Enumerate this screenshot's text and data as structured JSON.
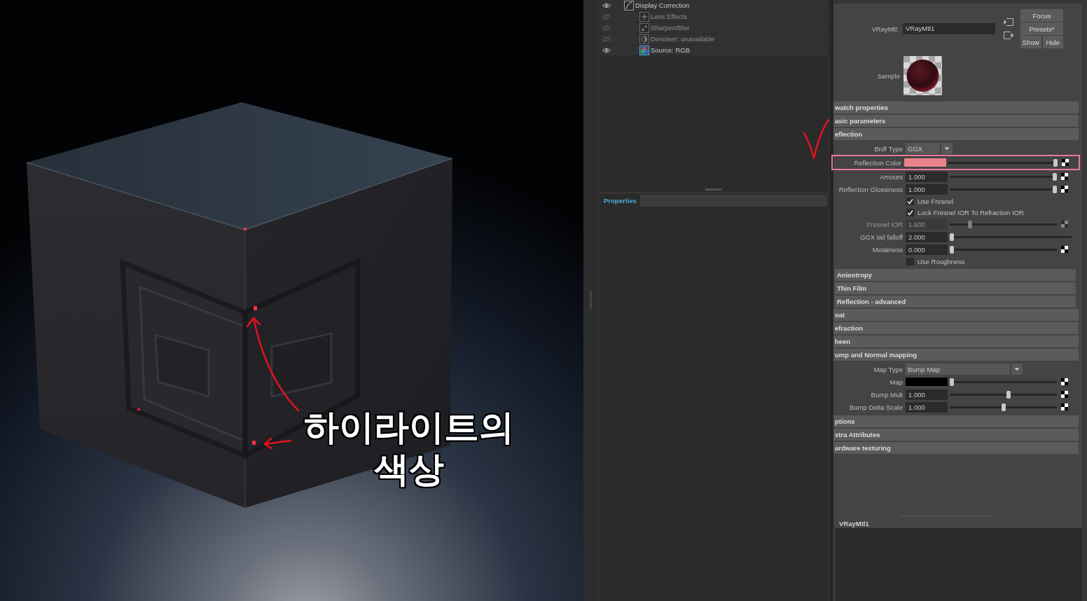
{
  "render": {
    "caption_lines": [
      "하이라이트의",
      "색상"
    ]
  },
  "layers": [
    {
      "name": "Display Correction",
      "kind": "correction",
      "visible": true,
      "children": [
        {
          "name": "Lens Effects",
          "kind": "lens",
          "visible": false
        },
        {
          "name": "Sharpen/Blur",
          "kind": "sharpen",
          "visible": false
        },
        {
          "name": "Denoiser: unavailable",
          "kind": "denoiser",
          "visible": false
        },
        {
          "name": "Source: RGB",
          "kind": "source",
          "visible": true
        }
      ]
    }
  ],
  "properties_tab": {
    "label": "Properties"
  },
  "material": {
    "type_label": "VRayMtl:",
    "name": "VRayMtl1",
    "sample_label": "Sample",
    "button_rows": [
      [
        "Focus"
      ],
      [
        "Presets*"
      ],
      [
        "Show",
        "Hide"
      ]
    ]
  },
  "sections": [
    {
      "title": "watch properties"
    },
    {
      "title": "asic parameters"
    },
    {
      "title": "eflection",
      "rows": [
        {
          "kind": "dropdown",
          "label": "Brdf Type",
          "value": "GGX",
          "disabled": false,
          "highlighted": false
        },
        {
          "kind": "color",
          "label": "Reflection Color",
          "color": "#e8848a",
          "level": 1,
          "map_button": true,
          "disabled": false,
          "highlighted": true
        },
        {
          "kind": "number",
          "label": "Amount",
          "value": "1.000",
          "level": 1,
          "map_button": true,
          "disabled": false,
          "highlighted": false
        },
        {
          "kind": "number",
          "label": "Reflection Glossiness",
          "value": "1.000",
          "level": 1,
          "map_button": true,
          "disabled": false,
          "highlighted": false
        },
        {
          "kind": "checkbox",
          "label": "Use Fresnel",
          "checked": true,
          "disabled": false,
          "highlighted": false
        },
        {
          "kind": "checkbox",
          "label": "Lock Fresnel IOR To Refraction IOR",
          "checked": true,
          "disabled": false,
          "highlighted": false
        },
        {
          "kind": "number",
          "label": "Fresnel IOR",
          "value": "1.600",
          "level": 0.18,
          "map_button": true,
          "disabled": true,
          "highlighted": false
        },
        {
          "kind": "number",
          "label": "GGX tail falloff",
          "value": "2.000",
          "level": 0,
          "map_button": false,
          "disabled": false,
          "highlighted": false
        },
        {
          "kind": "number",
          "label": "Metalness",
          "value": "0.000",
          "level": 0,
          "map_button": true,
          "disabled": false,
          "highlighted": false
        },
        {
          "kind": "checkbox",
          "label": "Use Roughness",
          "checked": false,
          "disabled": false,
          "highlighted": false
        }
      ],
      "subsections": [
        {
          "title": "Anisotropy"
        },
        {
          "title": "Thin Film"
        },
        {
          "title": "Reflection - advanced"
        }
      ]
    },
    {
      "title": "oat"
    },
    {
      "title": "efraction"
    },
    {
      "title": "heen"
    },
    {
      "title": "ump and Normal mapping",
      "rows": [
        {
          "kind": "dropdown",
          "label": "Map Type",
          "value": "Bump Map",
          "disabled": false,
          "highlighted": false
        },
        {
          "kind": "color",
          "label": "Map",
          "color": "#000000",
          "level": 0,
          "map_button": true,
          "disabled": false,
          "highlighted": false
        },
        {
          "kind": "number",
          "label": "Bump Mult",
          "value": "1.000",
          "level": 0.55,
          "map_button": true,
          "disabled": false,
          "highlighted": false
        },
        {
          "kind": "number",
          "label": "Bump Delta Scale",
          "value": "1.000",
          "level": 0.5,
          "map_button": true,
          "disabled": false,
          "highlighted": false
        }
      ]
    },
    {
      "title": "ptions"
    },
    {
      "title": "xtra Attributes"
    },
    {
      "title": "ardware texturing"
    }
  ],
  "swatch_panel": {
    "title": "VRayMtl1"
  }
}
